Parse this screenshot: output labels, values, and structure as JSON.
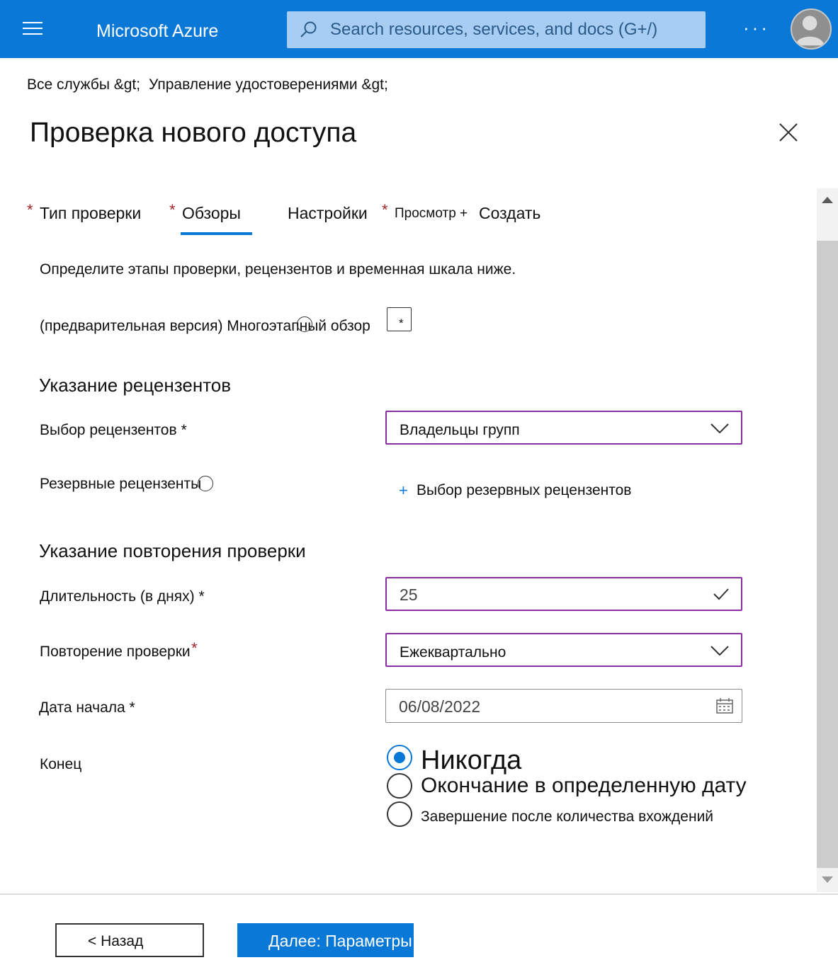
{
  "topbar": {
    "brand": "Microsoft Azure",
    "search_placeholder": "Search resources, services, and docs (G+/)",
    "more_label": "···"
  },
  "breadcrumb": {
    "items": [
      "Все службы &gt;",
      "Управление удостоверениями &gt;"
    ]
  },
  "page": {
    "title": "Проверка нового доступа"
  },
  "tabs": {
    "review_type": "Тип проверки",
    "reviews": "Обзоры",
    "settings": "Настройки",
    "review_create_1": "Просмотр +",
    "review_create_2": "Создать",
    "required_mark": "*"
  },
  "content": {
    "intro": "Определите этапы проверки, рецензентов и временная шкала ниже.",
    "multistage_label": "(предварительная версия) Многоэтапный обзор",
    "multistage_mark": "*",
    "section_reviewers": "Указание рецензентов",
    "select_reviewers_label": "Выбор рецензентов *",
    "select_reviewers_value": "Владельцы групп",
    "fallback_reviewers_label": "Резервные рецензенты",
    "fallback_reviewers_link": "Выбор резервных рецензентов",
    "section_recurrence": "Указание повторения проверки",
    "duration_label": "Длительность (в днях) *",
    "duration_value": "25",
    "recurrence_label": "Повторение проверки",
    "recurrence_value": "Ежеквартально",
    "start_date_label": "Дата начала *",
    "start_date_value": "06/08/2022",
    "end_label": "Конец",
    "end_options": [
      {
        "label": "Никогда",
        "checked": true
      },
      {
        "label": "Окончание в определенную дату",
        "checked": false
      },
      {
        "label": "Завершение после количества вхождений",
        "checked": false
      }
    ]
  },
  "footer": {
    "back_label": "<  Назад",
    "next_label": "Далее: Параметры"
  },
  "colors": {
    "brand_blue": "#0a78d7",
    "focus_purple": "#8a2da5",
    "required_red": "#a4262c"
  }
}
